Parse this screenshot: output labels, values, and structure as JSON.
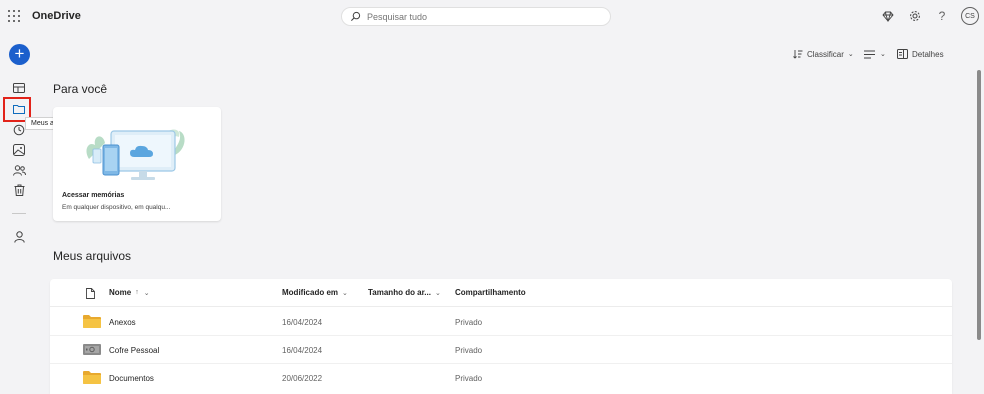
{
  "header": {
    "app_name": "OneDrive",
    "search_placeholder": "Pesquisar tudo",
    "avatar_initials": "CS",
    "icons": [
      "app-launcher-icon",
      "premium-diamond-icon",
      "settings-gear-icon",
      "help-icon"
    ]
  },
  "rail": {
    "create_label": "+",
    "tooltip": "Meus arquivos",
    "items": [
      "home-icon",
      "my-files-folder-icon",
      "recent-icon",
      "photos-icon",
      "shared-icon",
      "recycle-bin-icon",
      "people-icon"
    ]
  },
  "commandbar": {
    "sort_label": "Classificar",
    "details_label": "Detalhes"
  },
  "for_you": {
    "title": "Para você",
    "card": {
      "title": "Acessar memórias",
      "subtitle": "Em qualquer dispositivo, em qualqu..."
    }
  },
  "my_files": {
    "title": "Meus arquivos",
    "columns": {
      "name": "Nome",
      "name_sort": "↑",
      "modified": "Modificado em",
      "size": "Tamanho do ar...",
      "sharing": "Compartilhamento"
    },
    "rows": [
      {
        "name": "Anexos",
        "modified": "16/04/2024",
        "sharing": "Privado",
        "icon": "folder-icon"
      },
      {
        "name": "Cofre Pessoal",
        "modified": "16/04/2024",
        "sharing": "Privado",
        "icon": "vault-icon"
      },
      {
        "name": "Documentos",
        "modified": "20/06/2022",
        "sharing": "Privado",
        "icon": "folder-icon"
      }
    ]
  },
  "colors": {
    "accent": "#0f6cbd",
    "create_button": "#1b5fcc",
    "highlight_box": "#e2231a",
    "folder": "#f5c343"
  }
}
